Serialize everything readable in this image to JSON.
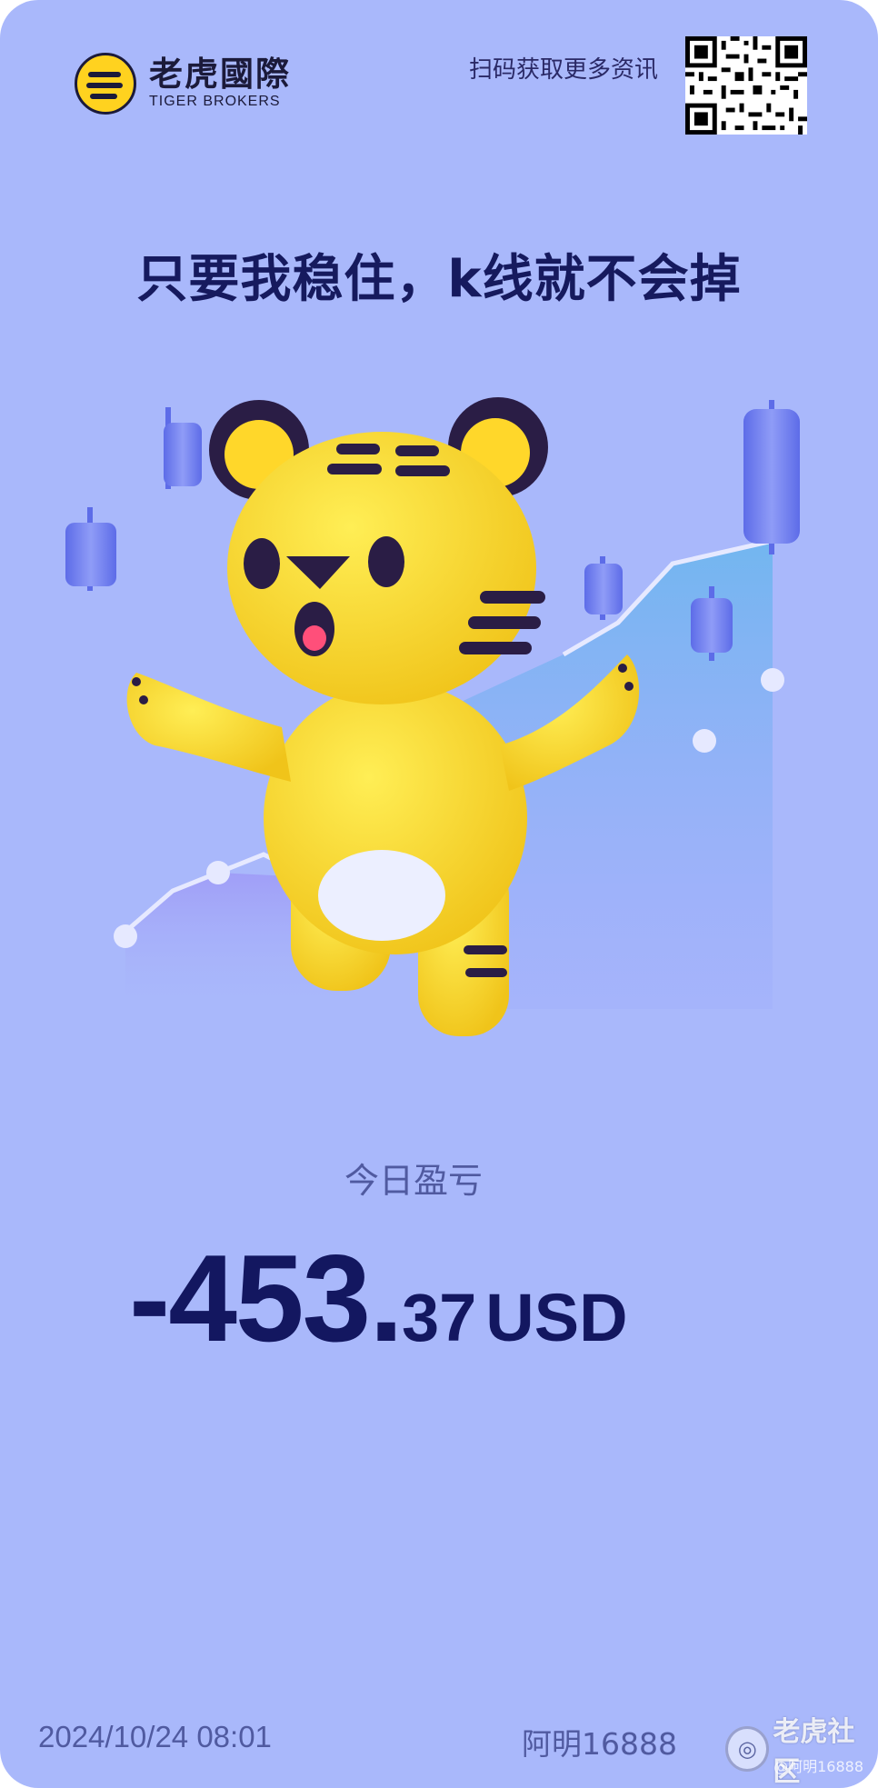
{
  "header": {
    "brand_cn": "老虎國際",
    "brand_en": "TIGER BROKERS",
    "qr_label": "扫码获取更多资讯"
  },
  "headline": "只要我稳住，k线就不会掉",
  "pnl": {
    "label": "今日盈亏",
    "integer_part": "-453.",
    "decimal_part": "37",
    "currency": "USD"
  },
  "footer": {
    "datetime": "2024/10/24 08:01",
    "username": "阿明16888",
    "community_label": "老虎社区",
    "watermark": "@阿明16888"
  },
  "colors": {
    "background": "#a9b8fb",
    "headline": "#161a5e",
    "tiger": "#ffd21f",
    "candles": "#6f7df0"
  }
}
